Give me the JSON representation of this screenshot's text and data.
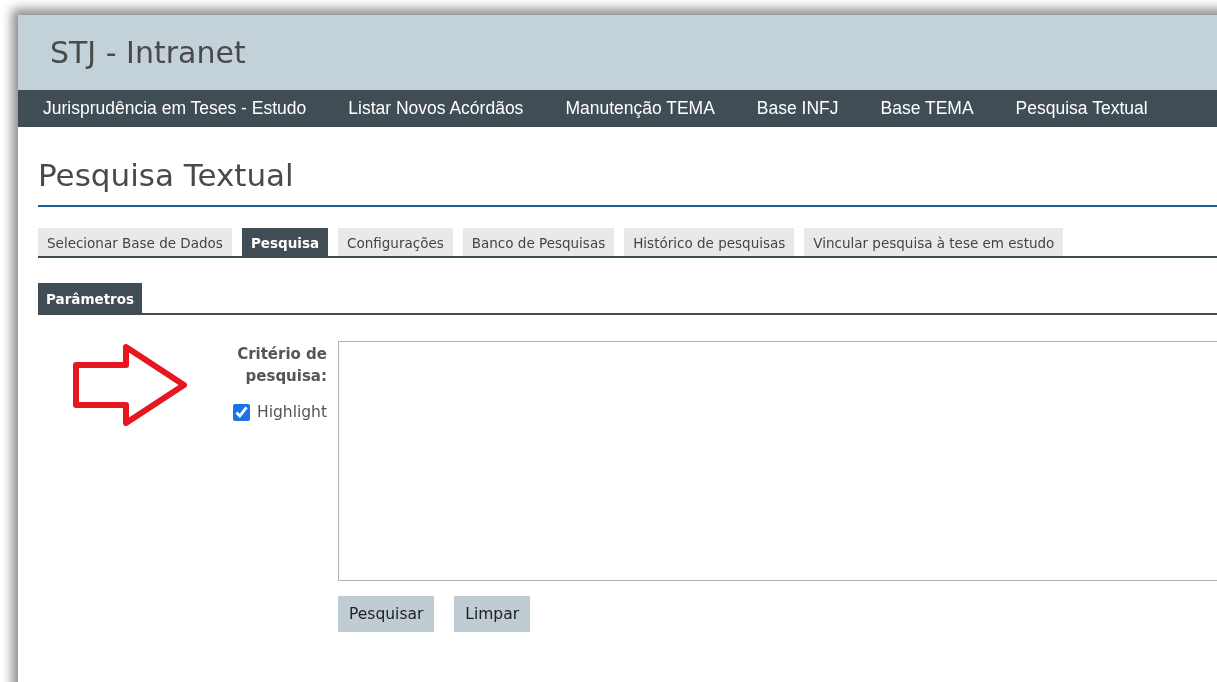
{
  "header": {
    "title": "STJ - Intranet"
  },
  "nav": {
    "items": [
      "Jurisprudência em Teses - Estudo",
      "Listar Novos Acórdãos",
      "Manutenção TEMA",
      "Base INFJ",
      "Base TEMA",
      "Pesquisa Textual"
    ]
  },
  "page": {
    "title": "Pesquisa Textual"
  },
  "tabs": [
    {
      "label": "Selecionar Base de Dados",
      "selected": false
    },
    {
      "label": "Pesquisa",
      "selected": true
    },
    {
      "label": "Configurações",
      "selected": false
    },
    {
      "label": "Banco de Pesquisas",
      "selected": false
    },
    {
      "label": "Histórico de pesquisas",
      "selected": false
    },
    {
      "label": "Vincular pesquisa à tese em estudo",
      "selected": false
    }
  ],
  "subtabs": [
    {
      "label": "Parâmetros",
      "selected": true
    }
  ],
  "form": {
    "label": "Critério de pesquisa:",
    "highlight": {
      "label": "Highlight",
      "checked": true
    },
    "buttons": [
      "Pesquisar",
      "Limpar"
    ]
  }
}
